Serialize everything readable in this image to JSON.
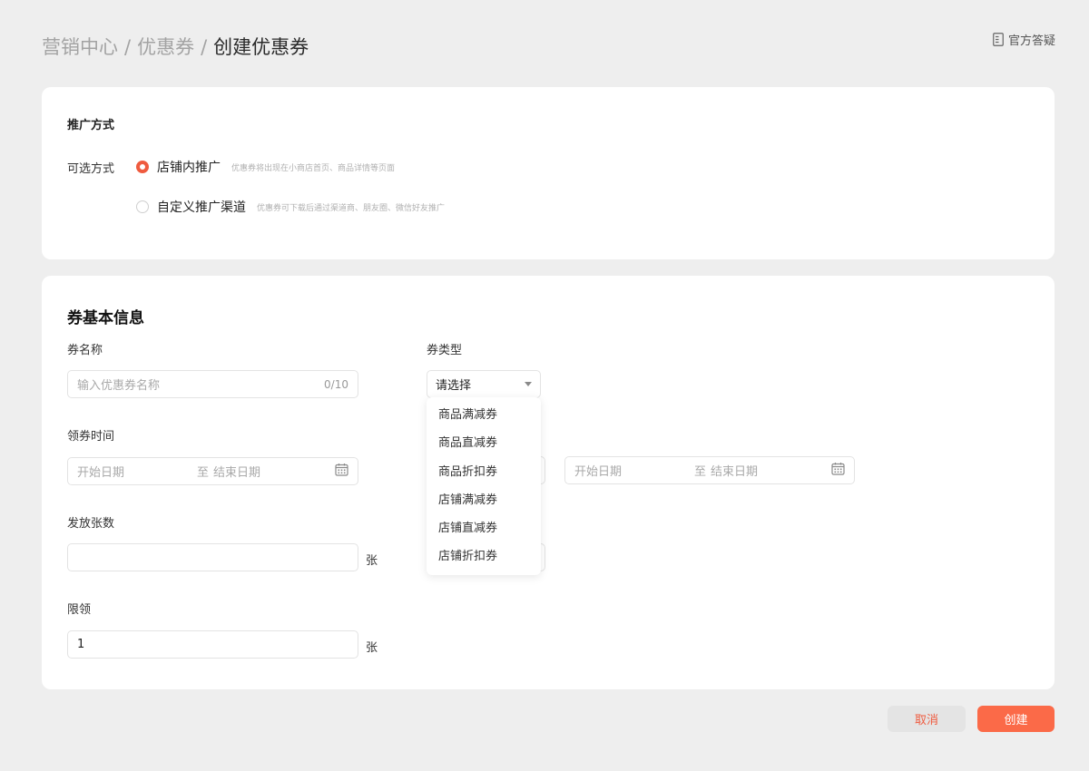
{
  "header": {
    "breadcrumb": [
      "营销中心",
      "优惠券"
    ],
    "separator": "/",
    "current": "创建优惠券",
    "faq_label": "官方答疑",
    "faq_icon": "document-icon"
  },
  "promotion": {
    "title": "推广方式",
    "options_label": "可选方式",
    "options": [
      {
        "label": "店铺内推广",
        "hint": "优惠券将出现在小商店首页、商品详情等页面",
        "checked": true
      },
      {
        "label": "自定义推广渠道",
        "hint": "优惠券可下载后通过渠道商、朋友圈、微信好友推广",
        "checked": false
      }
    ]
  },
  "basic": {
    "title": "券基本信息",
    "name": {
      "label": "券名称",
      "placeholder": "输入优惠券名称",
      "counter": "0/10"
    },
    "type": {
      "label": "券类型",
      "value": "请选择"
    },
    "claim_time": {
      "label": "领券时间",
      "start": "开始日期",
      "to": "至",
      "end": "结束日期"
    },
    "use_time": {
      "start": "开始日期",
      "to": "至",
      "end": "结束日期"
    },
    "issue_count": {
      "label": "发放张数",
      "value": "",
      "unit": "张"
    },
    "limit": {
      "label": "限领",
      "value": "1",
      "unit": "张"
    }
  },
  "type_dropdown": {
    "options": [
      "商品满减券",
      "商品直减券",
      "商品折扣券",
      "店铺满减券",
      "店铺直减券",
      "店铺折扣券"
    ]
  },
  "footer": {
    "cancel": "取消",
    "create": "创建"
  },
  "colors": {
    "accent": "#ef5b3f",
    "primary_button": "#fb6a48",
    "background": "#eeeeee"
  }
}
